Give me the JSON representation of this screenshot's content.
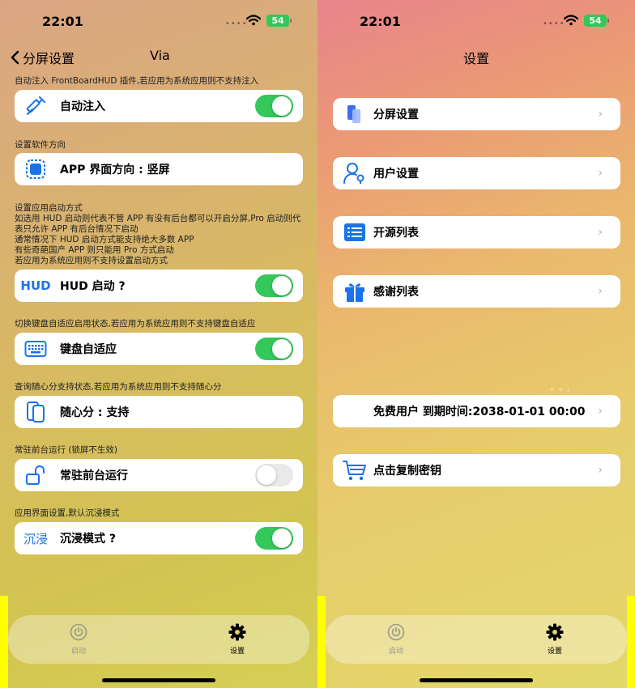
{
  "left": {
    "status": {
      "time": "22:01",
      "battery": "54"
    },
    "nav": {
      "back_label": "分屏设置",
      "title": "Via"
    },
    "sections": [
      {
        "header": "自动注入 FrontBoardHUD 插件,若应用为系统应用则不支持注入",
        "label": "自动注入",
        "icon": "syringe-icon",
        "control": "toggle",
        "on": true
      },
      {
        "header": "设置软件方向",
        "label": "APP 界面方向 : 竖屏",
        "icon": "screen-frame-icon",
        "control": "none"
      },
      {
        "header": "设置应用启动方式\n如选用 HUD 启动则代表不管 APP 有没有后台都可以开启分屏,Pro 启动则代表只允许 APP 有后台情况下启动\n通常情况下 HUD 启动方式能支持绝大多数 APP\n有些奇葩国产 APP 则只能用 Pro 方式启动\n若应用为系统应用则不支持设置启动方式",
        "label": "HUD 启动 ?",
        "icon_text": "HUD",
        "control": "toggle",
        "on": true
      },
      {
        "header": "切换键盘自适应启用状态,若应用为系统应用则不支持键盘自适应",
        "label": "键盘自适应",
        "icon": "keyboard-icon",
        "control": "toggle",
        "on": true
      },
      {
        "header": "查询随心分支持状态,若应用为系统应用则不支持随心分",
        "label": "随心分 : 支持",
        "icon": "split-phone-icon",
        "control": "none"
      },
      {
        "header": "常驻前台运行 (锁屏不生效)",
        "label": "常驻前台运行",
        "icon": "unlock-icon",
        "control": "toggle",
        "on": false
      },
      {
        "header": "应用界面设置,默认沉浸模式",
        "label": "沉浸模式 ?",
        "icon_text": "沉浸",
        "control": "toggle",
        "on": true
      }
    ],
    "tabs": [
      {
        "label": "启动",
        "icon": "power-icon"
      },
      {
        "label": "设置",
        "icon": "gear-icon"
      }
    ]
  },
  "right": {
    "status": {
      "time": "22:01",
      "battery": "54"
    },
    "nav": {
      "title": "设置"
    },
    "items": [
      {
        "label": "分屏设置",
        "icon": "split-screen-icon"
      },
      {
        "label": "用户设置",
        "icon": "user-key-icon"
      },
      {
        "label": "开源列表",
        "icon": "list-icon"
      },
      {
        "label": "感谢列表",
        "icon": "gift-icon"
      },
      {
        "label": "免费用户  到期时间:2038-01-01 00:00",
        "icon": "none"
      },
      {
        "label": "点击复制密钥",
        "icon": "cart-icon"
      }
    ],
    "mini_text": "ᴴ ᵁ ᴶ",
    "tabs": [
      {
        "label": "启动",
        "icon": "power-icon"
      },
      {
        "label": "设置",
        "icon": "gear-icon"
      }
    ]
  },
  "colors": {
    "toggle_on": "#34c759",
    "accent": "#1a73e8"
  }
}
